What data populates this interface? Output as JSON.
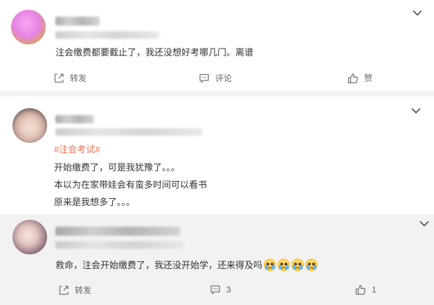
{
  "comments": [
    {
      "text": "注会缴费都要截止了，我还没想好考哪几门。离谱",
      "actions": {
        "repost": "转发",
        "comment": "评论",
        "like": "赞"
      }
    },
    {
      "hashtag": "#注会考试#",
      "lines": [
        "开始缴费了，可是我犹豫了。。。",
        "本以为在家带娃会有蛮多时间可以看书",
        "原来是我想多了。。。"
      ]
    },
    {
      "text": "救命，注会开始缴费了，我还没开始学，还来得及吗",
      "emoji": [
        "crying-emoji",
        "crying-emoji",
        "crying-emoji",
        "crying-emoji"
      ],
      "actions": {
        "repost": "转发",
        "comment_count": "3",
        "like_count": "1"
      }
    }
  ],
  "colors": {
    "hashtag": "#eb7350",
    "background": "#f2f2f2",
    "card": "#ffffff"
  }
}
